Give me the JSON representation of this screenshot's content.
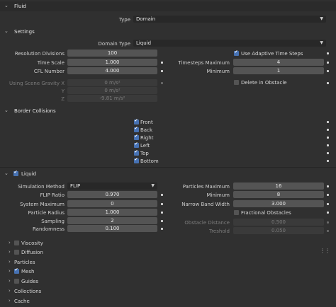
{
  "fluid": {
    "header": "Fluid",
    "type_label": "Type",
    "type_value": "Domain"
  },
  "settings": {
    "header": "Settings",
    "domain_type_label": "Domain Type",
    "domain_type_value": "Liquid",
    "resolution_label": "Resolution Divisions",
    "resolution_value": "100",
    "time_scale_label": "Time Scale",
    "time_scale_value": "1.000",
    "cfl_label": "CFL Number",
    "cfl_value": "4.000",
    "use_adaptive_label": "Use Adaptive Time Steps",
    "timesteps_max_label": "Timesteps Maximum",
    "timesteps_max_value": "4",
    "minimum_label": "Minimum",
    "minimum_value": "1",
    "gravity_x_label": "Using Scene Gravity X",
    "gravity_x_value": "0 m/s²",
    "gravity_y_label": "Y",
    "gravity_y_value": "0 m/s²",
    "gravity_z_label": "Z",
    "gravity_z_value": "-9.81 m/s²",
    "delete_obstacle_label": "Delete in Obstacle"
  },
  "border": {
    "header": "Border Collisions",
    "items": [
      "Front",
      "Back",
      "Right",
      "Left",
      "Top",
      "Bottom"
    ]
  },
  "liquid": {
    "header": "Liquid",
    "sim_method_label": "Simulation Method",
    "sim_method_value": "FLIP",
    "flip_ratio_label": "FLIP Ratio",
    "flip_ratio_value": "0.970",
    "system_max_label": "System Maximum",
    "system_max_value": "0",
    "particle_radius_label": "Particle Radius",
    "particle_radius_value": "1.000",
    "sampling_label": "Sampling",
    "sampling_value": "2",
    "randomness_label": "Randomness",
    "randomness_value": "0.100",
    "particles_max_label": "Particles Maximum",
    "particles_max_value": "16",
    "minimum_label": "Minimum",
    "minimum_value": "8",
    "narrow_band_label": "Narrow Band Width",
    "narrow_band_value": "3.000",
    "fractional_label": "Fractional Obstacles",
    "obstacle_distance_label": "Obstacle Distance",
    "obstacle_distance_value": "0.500",
    "threshold_label": "Treshold",
    "threshold_value": "0.050"
  },
  "subpanels": {
    "viscosity": "Viscosity",
    "diffusion": "Diffusion",
    "particles": "Particles",
    "mesh": "Mesh",
    "guides": "Guides",
    "collections": "Collections",
    "cache": "Cache"
  },
  "colors": {
    "accent": "#4772b3",
    "background": "#303030",
    "field": "#545454"
  }
}
